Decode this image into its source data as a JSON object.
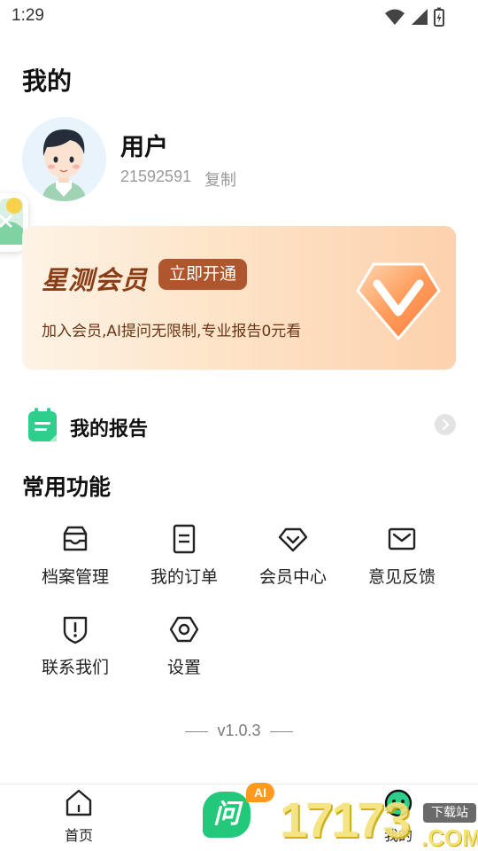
{
  "status_bar": {
    "time": "1:29",
    "icons": [
      "wifi-icon",
      "signal-icon",
      "battery-icon"
    ]
  },
  "page_title": "我的",
  "profile": {
    "username": "用户",
    "user_id": "21592591",
    "copy_label": "复制"
  },
  "vip_card": {
    "title": "星测会员",
    "open_button": "立即开通",
    "description": "加入会员,AI提问无限制,专业报告0元看",
    "colors": {
      "button": "#b0562e",
      "title": "#8a3d16"
    }
  },
  "report": {
    "label": "我的报告",
    "icon": "report-icon"
  },
  "functions": {
    "title": "常用功能",
    "items": [
      {
        "label": "档案管理",
        "icon": "inbox-icon"
      },
      {
        "label": "我的订单",
        "icon": "document-icon"
      },
      {
        "label": "会员中心",
        "icon": "diamond-icon"
      },
      {
        "label": "意见反馈",
        "icon": "envelope-icon"
      },
      {
        "label": "联系我们",
        "icon": "shield-alert-icon"
      },
      {
        "label": "设置",
        "icon": "hexagon-settings-icon"
      }
    ]
  },
  "version": "v1.0.3",
  "tab_bar": {
    "home_label": "首页",
    "ai_label": "问",
    "ai_tag": "AI",
    "mine_label": "我的"
  },
  "watermark": {
    "number": "17173",
    "site": "下载站",
    "domain": ".COM"
  }
}
